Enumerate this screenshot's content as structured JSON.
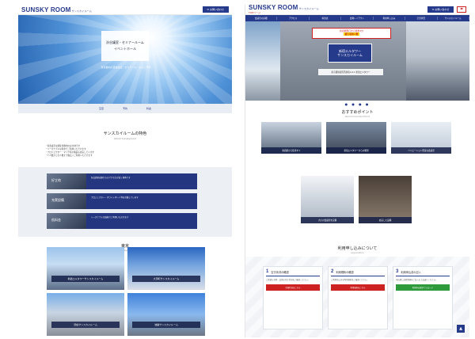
{
  "left": {
    "logo": "SUNSKY ROOM",
    "logo_small": "サンスカイルーム",
    "contact_label": "✉ お問い合わせ",
    "hero_lines": [
      "渋谷議室・セミナールーム",
      "イベントホール"
    ],
    "hero_sub": "東京都内の貸会議室・セミナールームのご予約",
    "icon_items": [
      "空室",
      "予約",
      "料金"
    ],
    "features_title": "サンスカイルームの特色",
    "features_sub": "About Sunskyroom",
    "bullets": [
      "・各会議室は駅徒歩圏内の好立地です",
      "・リーズナブルな料金でご利用いただけます",
      "・プロジェクター・マイク等の備品も充実しています",
      "・少人数から大人数まで幅広くご利用いただけます"
    ],
    "feature_rows": [
      {
        "label": "好立地",
        "text": "各会議室は駅からのアクセスが良く便利です"
      },
      {
        "label": "充実設備",
        "text": "プロジェクター・ホワイトボード等を完備しています"
      },
      {
        "label": "低料金",
        "text": "リーズナブルな価格でご利用いただけます"
      }
    ],
    "tokyo_title": "東京",
    "tokyo_sub": "Tokyo",
    "buildings": [
      "新宿エルタワーサンスカイルーム",
      "大手町サンスカイルーム",
      "渋谷サンスカイルーム",
      "池袋サンスカイルーム"
    ]
  },
  "right": {
    "logo": "SUNSKY ROOM",
    "logo_small": "サンスカイルーム",
    "logo_sub": "TOPページ",
    "contact_label": "✉ お問い合わせ",
    "nav": [
      "会議室の詳細",
      "アクセス",
      "料金表",
      "会場レイアウト",
      "利用申し込み",
      "空室状況",
      "サンスカイルーム"
    ],
    "badge_text": "新宿駅西口から徒歩3分",
    "badge_highlight": "最大収容人数",
    "main_card": [
      "新宿エルタワー",
      "サンスカイルーム"
    ],
    "address": "東京都新宿区西新宿1-6-1 新宿エルタワー",
    "dots": "● ● ● ●",
    "recommend_title": "おすすめポイント",
    "recommend_sub": "Recommended Point",
    "thumbs": [
      "新宿駅から徒歩すぐ",
      "新宿エルタワーからの眺望",
      "バリエーション豊富な会議室",
      "大小の会議室を完備",
      "充実した設備"
    ],
    "apply_title": "利用申し込みについて",
    "apply_sub": "Application",
    "steps": [
      {
        "num": "1",
        "label": "空き状況の確認",
        "body": "ご希望の日時・会場の空き状況をご確認ください。",
        "btn": "空室状況はこちら"
      },
      {
        "num": "2",
        "label": "利用規約の確認",
        "body": "ご利用前に必ず利用規約をご確認ください。",
        "btn": "利用規約はこちら"
      },
      {
        "num": "3",
        "label": "利用申込書の記入",
        "body": "申込書に必要事項をご記入の上お送りください。",
        "btn": "利用申込書ダウンロード"
      }
    ],
    "pagetop": "▲"
  }
}
